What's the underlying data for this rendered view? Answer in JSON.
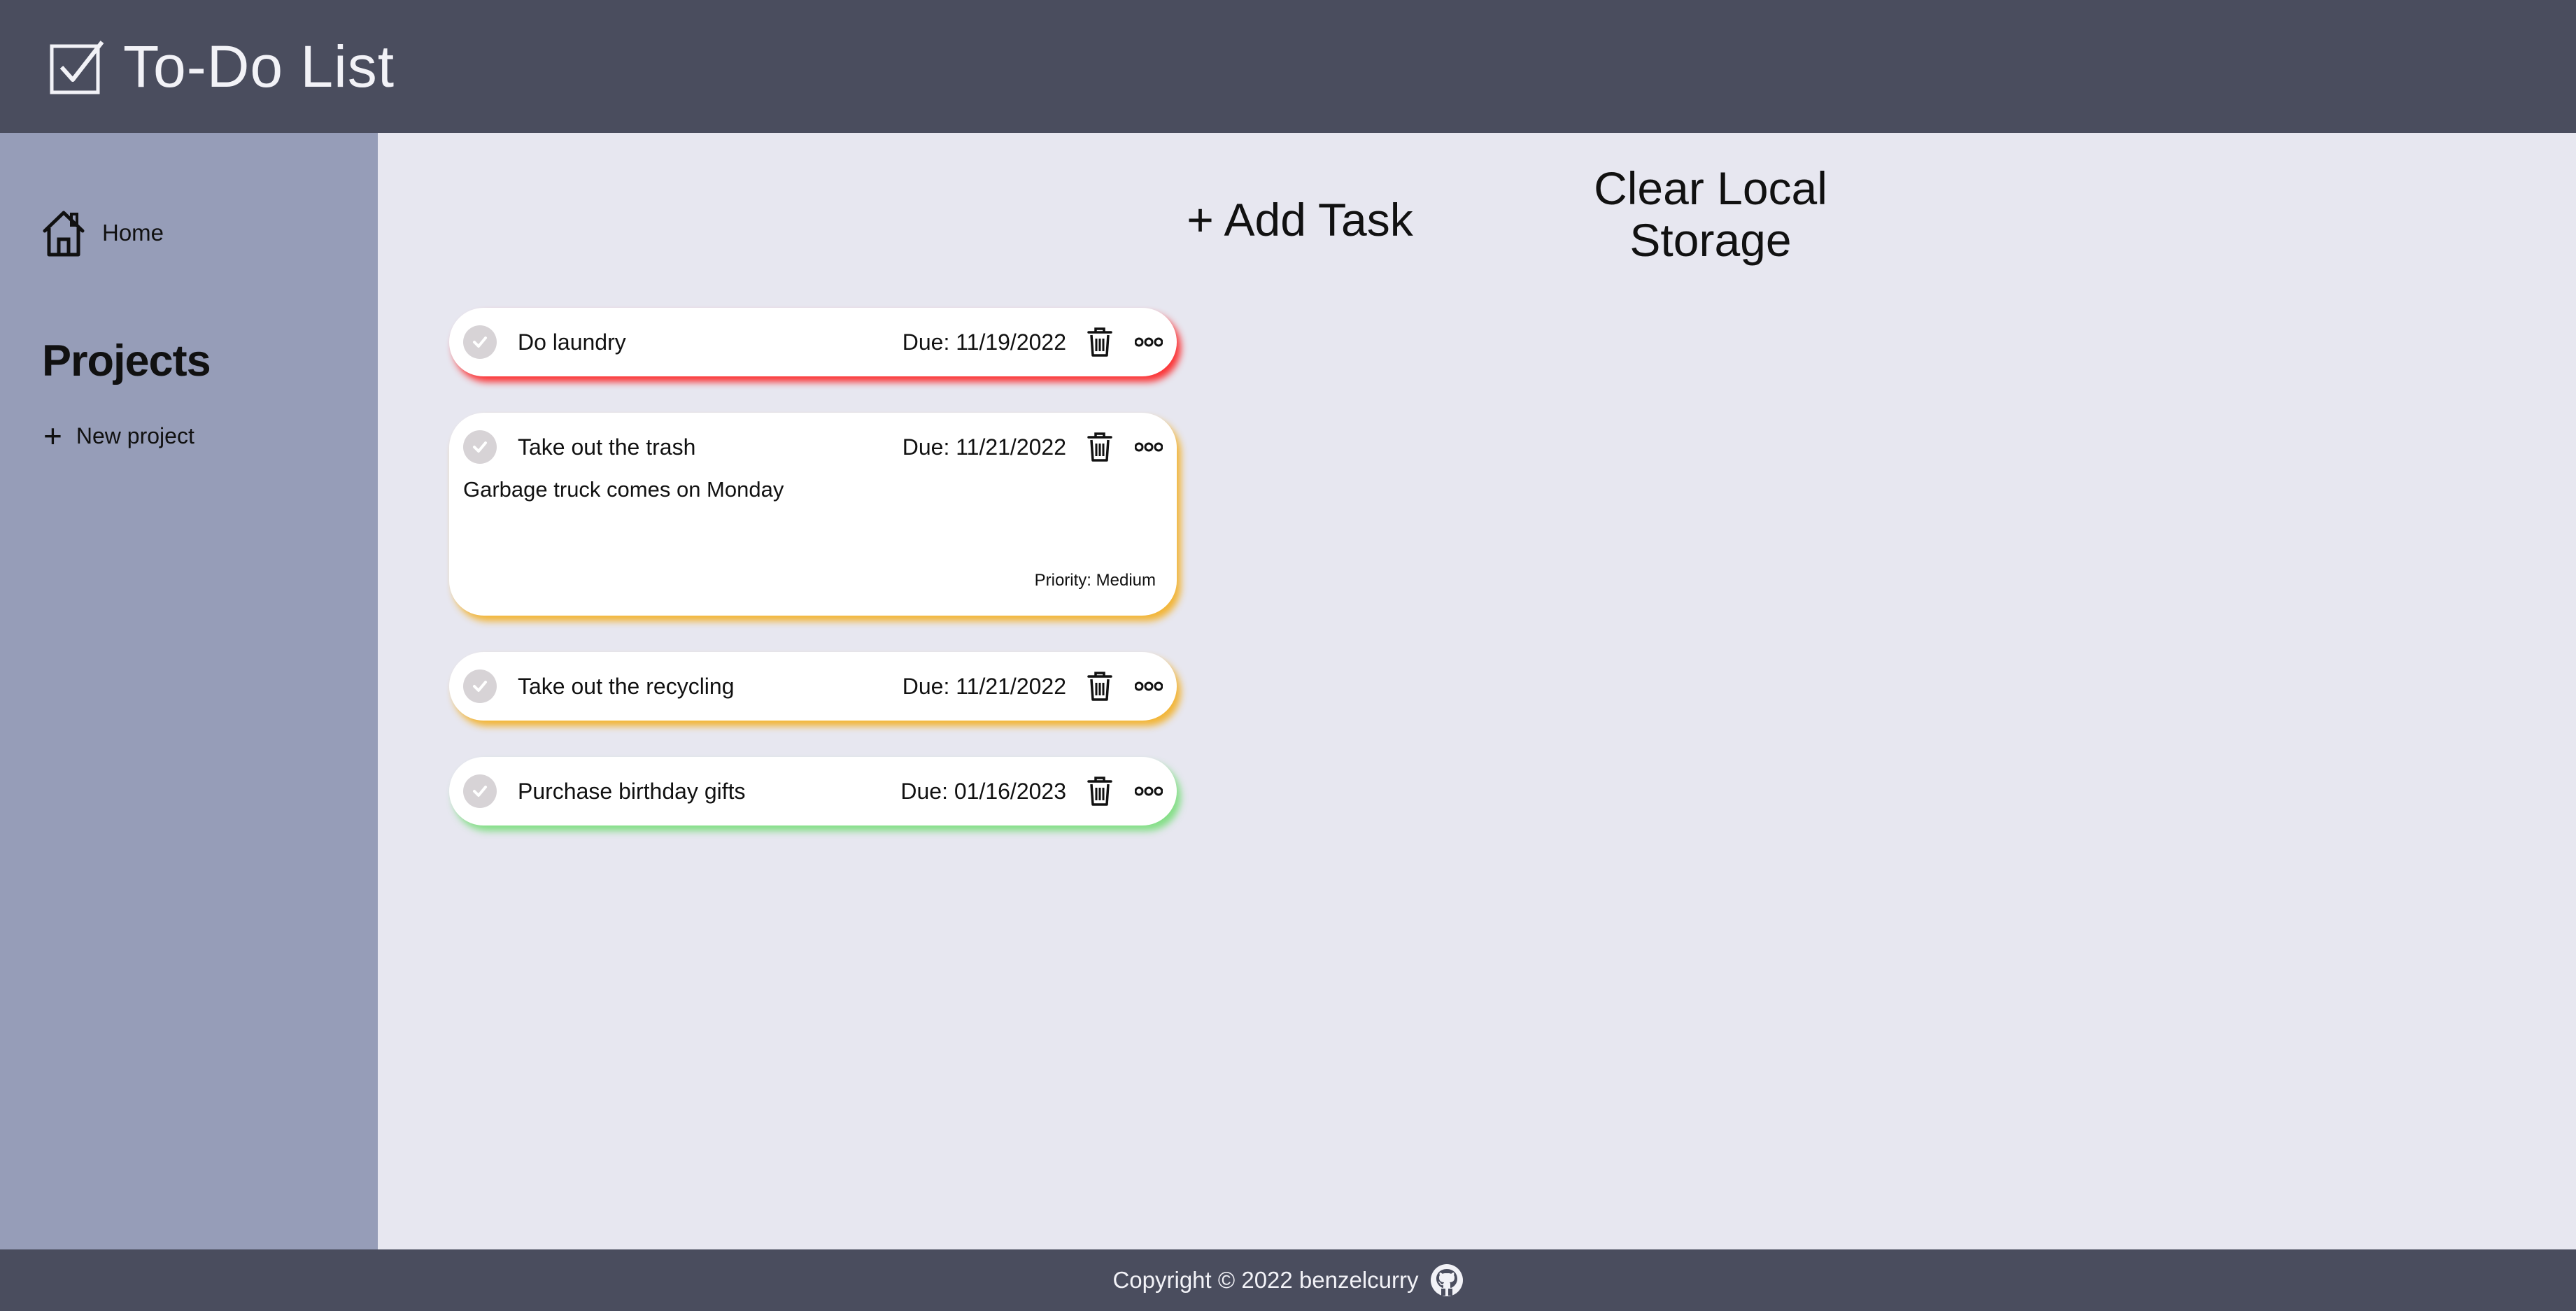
{
  "header": {
    "title": "To-Do List",
    "logo_icon": "checkbox-icon"
  },
  "sidebar": {
    "home_label": "Home",
    "projects_title": "Projects",
    "new_project_label": "New project"
  },
  "main": {
    "add_task_label": "+ Add Task",
    "clear_storage_label": "Clear Local Storage"
  },
  "tasks": [
    {
      "name": "Do laundry",
      "due": "Due: 11/19/2022",
      "priority_color": "#ff1414"
    },
    {
      "name": "Take out the trash",
      "due": "Due: 11/21/2022",
      "description": "Garbage truck comes on Monday",
      "priority": "Priority: Medium",
      "priority_color": "#f5ac14"
    },
    {
      "name": "Take out the recycling",
      "due": "Due: 11/21/2022",
      "priority_color": "#f5ac14"
    },
    {
      "name": "Purchase birthday gifts",
      "due": "Due: 01/16/2023",
      "priority_color": "#5adc5a"
    }
  ],
  "footer": {
    "copyright": "Copyright © 2022 benzelcurry",
    "icon": "github-icon"
  },
  "colors": {
    "header_bg": "#4a4d5e",
    "sidebar_bg": "#969db8",
    "main_bg": "#e7e7f0"
  }
}
